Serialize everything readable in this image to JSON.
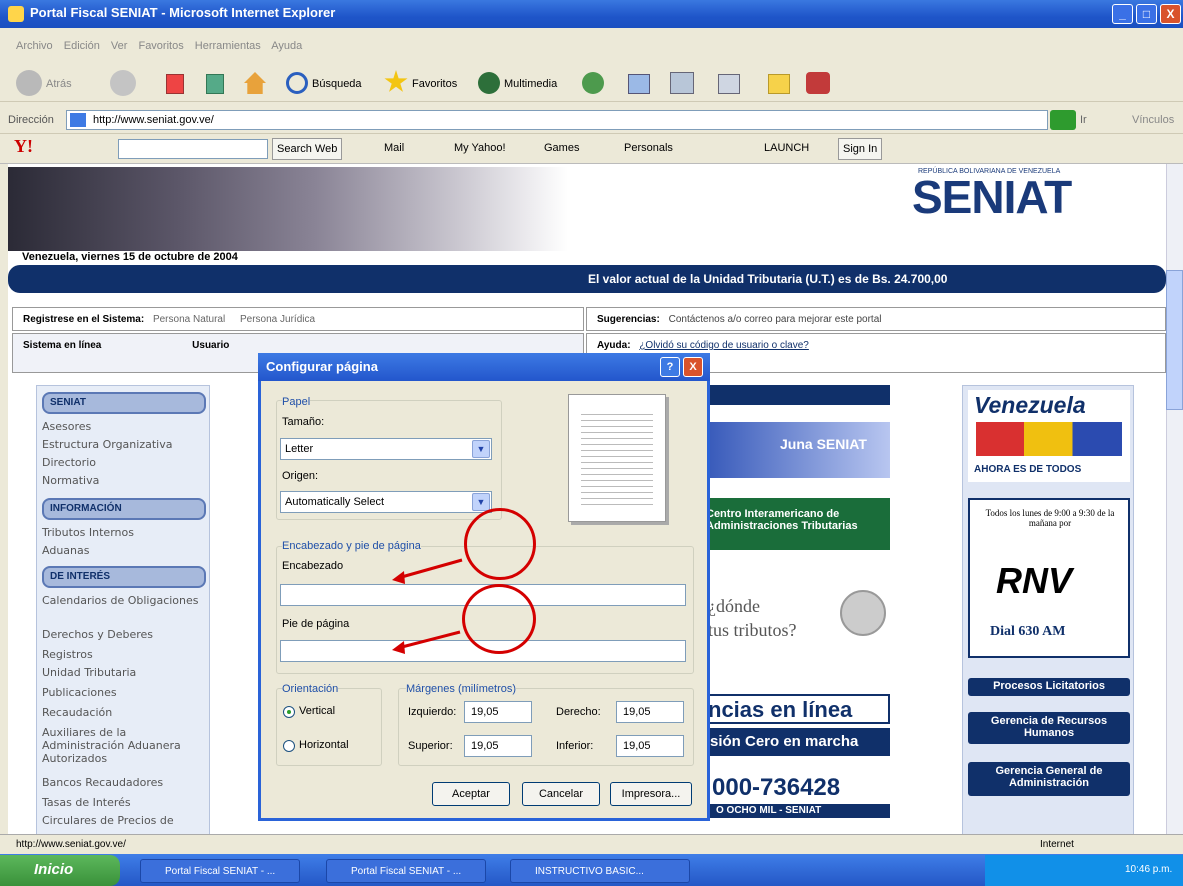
{
  "window": {
    "title": "Portal Fiscal SENIAT - Microsoft Internet Explorer",
    "minimize": "_",
    "maximize": "□",
    "close": "X"
  },
  "menubar": {
    "items": [
      "Archivo",
      "Edición",
      "Ver",
      "Favoritos",
      "Herramientas",
      "Ayuda"
    ]
  },
  "toolbar": {
    "back": "Atrás",
    "search": "Búsqueda",
    "favorites": "Favoritos",
    "multimedia": "Multimedia"
  },
  "address": {
    "label": "Dirección",
    "url": "http://www.seniat.gov.ve/",
    "go": "Ir",
    "links": "Vínculos"
  },
  "yahoo": {
    "search_web": "Search Web",
    "mail": "Mail",
    "my_yahoo": "My Yahoo!",
    "games": "Games",
    "personals": "Personals",
    "launch": "LAUNCH",
    "sign_in": "Sign In"
  },
  "site": {
    "republic": "REPÚBLICA BOLIVARIANA DE VENEZUELA",
    "logo": "SENIAT",
    "date": "Venezuela, viernes 15 de octubre de 2004",
    "ut_notice": "El valor actual de la Unidad Tributaria (U.T.) es de Bs. 24.700,00",
    "register_label": "Registrese en el Sistema:",
    "persona_natural": "Persona Natural",
    "persona_juridica": "Persona Jurídica",
    "suggestions_label": "Sugerencias:",
    "suggestions_text": "Contáctenos a/o correo para mejorar este portal",
    "online_label": "Sistema en línea",
    "user_label": "Usuario",
    "help_label": "Ayuda:",
    "help_text": "¿Olvidó su código de usuario o clave?",
    "nav": [
      {
        "header": "SENIAT",
        "items": [
          "Asesores",
          "Estructura Organizativa",
          "Directorio",
          "Normativa"
        ]
      },
      {
        "header": "INFORMACIÓN",
        "items": [
          "Tributos Internos",
          "Aduanas"
        ]
      },
      {
        "header": "DE INTERÉS",
        "items": [
          "Calendarios de Obligaciones",
          "Derechos y Deberes",
          "Registros",
          "Unidad Tributaria",
          "Publicaciones",
          "Recaudación",
          "Auxiliares de la Administración Aduanera Autorizados",
          "Bancos Recaudadores",
          "Tasas de Interés",
          "Circulares de Precios de"
        ]
      }
    ],
    "mid": {
      "juna": "Juna SENIAT",
      "cia": "Centro Interamericano de Administraciones Tributarias",
      "donde": "¿dónde",
      "tributos": "tus tributos?",
      "lineas": "ncias en línea",
      "cero": "sión Cero en marcha",
      "phone": "000-736428",
      "phone_sub": "O OCHO MIL - SENIAT"
    },
    "right": {
      "venezuela": "Venezuela",
      "todos": "AHORA ES DE TODOS",
      "rnv_text": "Todos los lunes de 9:00 a 9:30 de la mañana por",
      "rnv": "RNV",
      "dial": "Dial 630 AM",
      "procesos": "Procesos Licitatorios",
      "recursos": "Gerencia de Recursos Humanos",
      "administracion": "Gerencia General de Administración"
    }
  },
  "dialog": {
    "title": "Configurar página",
    "help": "?",
    "close": "X",
    "paper_group": "Papel",
    "size_label": "Tamaño:",
    "size_value": "Letter",
    "source_label": "Origen:",
    "source_value": "Automatically Select",
    "headers_group": "Encabezado y pie de página",
    "header_label": "Encabezado",
    "header_value": "",
    "footer_label": "Pie de página",
    "footer_value": "",
    "orientation_group": "Orientación",
    "vertical": "Vertical",
    "horizontal": "Horizontal",
    "margins_group": "Márgenes (milímetros)",
    "left_label": "Izquierdo:",
    "left_value": "19,05",
    "right_label": "Derecho:",
    "right_value": "19,05",
    "top_label": "Superior:",
    "top_value": "19,05",
    "bottom_label": "Inferior:",
    "bottom_value": "19,05",
    "accept": "Aceptar",
    "cancel": "Cancelar",
    "printer": "Impresora..."
  },
  "status": {
    "url": "http://www.seniat.gov.ve/",
    "zone": "Internet"
  },
  "taskbar": {
    "start": "Inicio",
    "tasks": [
      "Portal Fiscal SENIAT - ...",
      "Portal Fiscal SENIAT - ...",
      "INSTRUCTIVO BASIC..."
    ],
    "clock": "10:46 p.m."
  },
  "colors": {
    "accent": "#10306a",
    "highlight": "#d40000",
    "dialog_title": "#2a63d8"
  }
}
